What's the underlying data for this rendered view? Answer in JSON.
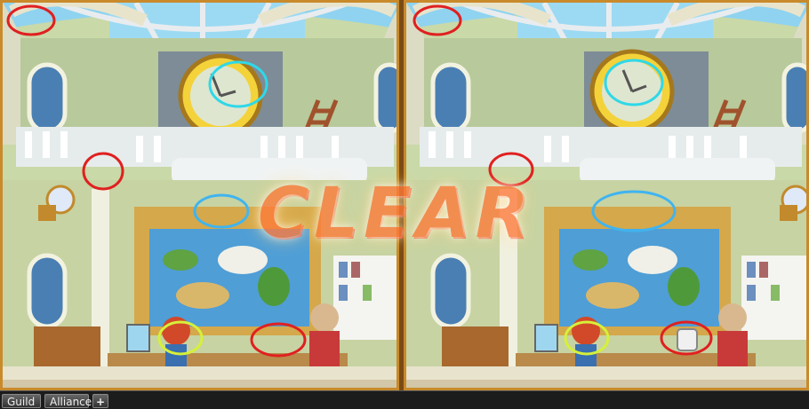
{
  "game": {
    "overlay_text": "CLEAR"
  },
  "bottom_bar": {
    "guild_label": "Guild",
    "alliance_label": "Alliance",
    "plus_label": "+"
  },
  "colors": {
    "frame": "#c98a2b",
    "sky": "#8fd3f0",
    "wall": "#b7c99a",
    "marker_red": "#e02020",
    "marker_blue": "#3fb4f0",
    "marker_yellow": "#d6f03a",
    "marker_cyan": "#2fd8e8"
  },
  "icons": [
    "clock-icon",
    "ladder-icon",
    "lamp-icon",
    "world-map-icon",
    "bookshelf-icon",
    "character-icon",
    "npc-icon"
  ]
}
